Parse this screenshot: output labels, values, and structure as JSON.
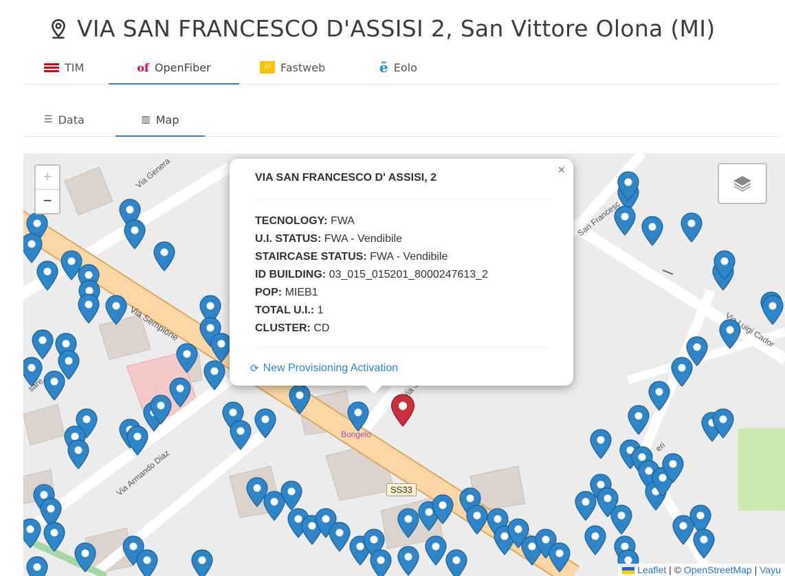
{
  "address_title": "VIA SAN FRANCESCO D'ASSISI 2, San Vittore Olona (MI)",
  "providers": [
    {
      "label": "TIM",
      "active": false
    },
    {
      "label": "OpenFiber",
      "logo_text": "of",
      "active": true
    },
    {
      "label": "Fastweb",
      "active": false
    },
    {
      "label": "Eolo",
      "active": false
    }
  ],
  "views": [
    {
      "label": "Data",
      "icon": "list-icon",
      "active": false
    },
    {
      "label": "Map",
      "icon": "map-icon",
      "active": true
    }
  ],
  "popup": {
    "title": "VIA SAN FRANCESCO D' ASSISI, 2",
    "close": "×",
    "fields": [
      {
        "label": "TECNOLOGY:",
        "value": "FWA"
      },
      {
        "label": "U.I. STATUS:",
        "value": "FWA - Vendibile"
      },
      {
        "label": "STAIRCASE STATUS:",
        "value": "FWA - Vendibile"
      },
      {
        "label": "ID BUILDING:",
        "value": "03_015_015201_8000247613_2"
      },
      {
        "label": "POP:",
        "value": "MIEB1"
      },
      {
        "label": "TOTAL U.I.:",
        "value": "1"
      },
      {
        "label": "CLUSTER:",
        "value": "CD"
      }
    ],
    "action": "New Provisioning Activation"
  },
  "map": {
    "zoom_in": "+",
    "zoom_out": "−",
    "labels": {
      "via_sempione": "Via Sempione",
      "via_armando_diaz": "Via Armando Diaz",
      "via_luigi_cadorna": "Via Luigi Cador",
      "via_generale": "Via Genera",
      "san_francesco": "San Francesc",
      "via_sa": "Via Sa",
      "poi_bongelo": "Bongelo",
      "road_shield": "SS33",
      "cesare": "sare",
      "oberi": "eri"
    },
    "attribution": {
      "leaflet": "Leaflet",
      "sep1": " | © ",
      "osm": "OpenStreetMap",
      "sep2": " | ",
      "vayu": "Vayu"
    }
  },
  "colors": {
    "tab_underline": "#3a7bd5",
    "pin_blue": "#2e86c8",
    "pin_red": "#c9303c",
    "link": "#2a8bc4"
  }
}
